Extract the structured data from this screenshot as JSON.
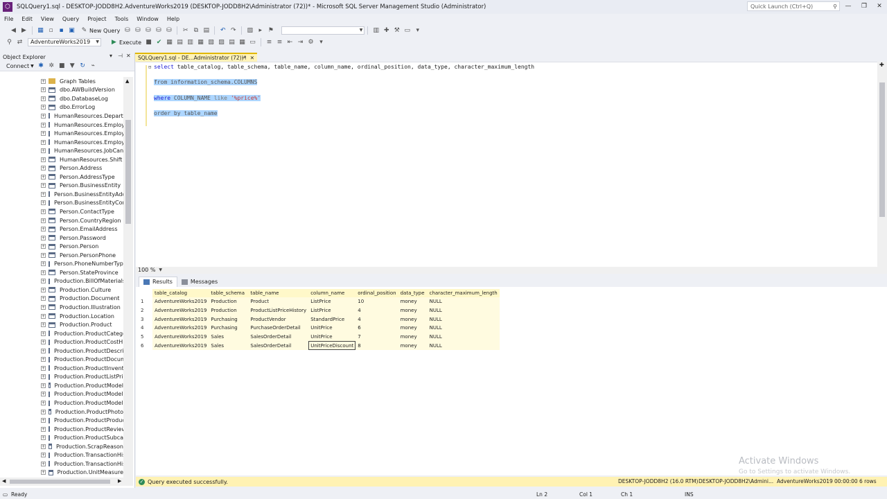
{
  "window": {
    "title": "SQLQuery1.sql - DESKTOP-JODD8H2.AdventureWorks2019 (DESKTOP-JODD8H2\\Administrator (72))* - Microsoft SQL Server Management Studio (Administrator)",
    "quick_launch_placeholder": "Quick Launch (Ctrl+Q)"
  },
  "menu": [
    "File",
    "Edit",
    "View",
    "Query",
    "Project",
    "Tools",
    "Window",
    "Help"
  ],
  "toolbar": {
    "new_query_label": "New Query",
    "database_combo_value": "AdventureWorks2019",
    "execute_label": "Execute"
  },
  "object_explorer": {
    "title": "Object Explorer",
    "connect_label": "Connect",
    "items": [
      {
        "label": "Graph Tables",
        "kind": "folder"
      },
      {
        "label": "dbo.AWBuildVersion",
        "kind": "table"
      },
      {
        "label": "dbo.DatabaseLog",
        "kind": "table"
      },
      {
        "label": "dbo.ErrorLog",
        "kind": "table"
      },
      {
        "label": "HumanResources.Departm",
        "kind": "table"
      },
      {
        "label": "HumanResources.Employe",
        "kind": "table"
      },
      {
        "label": "HumanResources.Employe",
        "kind": "table"
      },
      {
        "label": "HumanResources.Employe",
        "kind": "table"
      },
      {
        "label": "HumanResources.JobCand",
        "kind": "table"
      },
      {
        "label": "HumanResources.Shift",
        "kind": "table"
      },
      {
        "label": "Person.Address",
        "kind": "table"
      },
      {
        "label": "Person.AddressType",
        "kind": "table"
      },
      {
        "label": "Person.BusinessEntity",
        "kind": "table"
      },
      {
        "label": "Person.BusinessEntityAddre",
        "kind": "table"
      },
      {
        "label": "Person.BusinessEntityConta",
        "kind": "table"
      },
      {
        "label": "Person.ContactType",
        "kind": "table"
      },
      {
        "label": "Person.CountryRegion",
        "kind": "table"
      },
      {
        "label": "Person.EmailAddress",
        "kind": "table"
      },
      {
        "label": "Person.Password",
        "kind": "table"
      },
      {
        "label": "Person.Person",
        "kind": "table"
      },
      {
        "label": "Person.PersonPhone",
        "kind": "table"
      },
      {
        "label": "Person.PhoneNumberType",
        "kind": "table"
      },
      {
        "label": "Person.StateProvince",
        "kind": "table"
      },
      {
        "label": "Production.BillOfMaterials",
        "kind": "table"
      },
      {
        "label": "Production.Culture",
        "kind": "table"
      },
      {
        "label": "Production.Document",
        "kind": "table"
      },
      {
        "label": "Production.Illustration",
        "kind": "table"
      },
      {
        "label": "Production.Location",
        "kind": "table"
      },
      {
        "label": "Production.Product",
        "kind": "table"
      },
      {
        "label": "Production.ProductCatego",
        "kind": "table"
      },
      {
        "label": "Production.ProductCostHi",
        "kind": "table"
      },
      {
        "label": "Production.ProductDescrip",
        "kind": "table"
      },
      {
        "label": "Production.ProductDocum",
        "kind": "table"
      },
      {
        "label": "Production.ProductInvento",
        "kind": "table"
      },
      {
        "label": "Production.ProductListPric",
        "kind": "table"
      },
      {
        "label": "Production.ProductModel",
        "kind": "table"
      },
      {
        "label": "Production.ProductModelI",
        "kind": "table"
      },
      {
        "label": "Production.ProductModelP",
        "kind": "table"
      },
      {
        "label": "Production.ProductPhoto",
        "kind": "table"
      },
      {
        "label": "Production.ProductProduc",
        "kind": "table"
      },
      {
        "label": "Production.ProductReview",
        "kind": "table"
      },
      {
        "label": "Production.ProductSubcate",
        "kind": "table"
      },
      {
        "label": "Production.ScrapReason",
        "kind": "table"
      },
      {
        "label": "Production.TransactionHist",
        "kind": "table"
      },
      {
        "label": "Production.TransactionHist",
        "kind": "table"
      },
      {
        "label": "Production.UnitMeasure",
        "kind": "table"
      }
    ]
  },
  "document_tab": {
    "label": "SQLQuery1.sql - DE...Administrator (72))*"
  },
  "editor": {
    "lines": {
      "select_kw": "select",
      "select_rest": " table_catalog, table_schema, table_name, column_name, ordinal_position, data_type, character_maximum_length",
      "from_line": "from information_schema.COLUMNS",
      "where_kw": "where",
      "where_col": " COLUMN_NAME ",
      "where_like": "like ",
      "where_str": "'%price%'",
      "order_line": "order by table_name"
    },
    "zoom": "100 %"
  },
  "results": {
    "tabs": [
      "Results",
      "Messages"
    ],
    "columns": [
      "table_catalog",
      "table_schema",
      "table_name",
      "column_name",
      "ordinal_position",
      "data_type",
      "character_maximum_length"
    ],
    "rows": [
      [
        "1",
        "AdventureWorks2019",
        "Production",
        "Product",
        "ListPrice",
        "10",
        "money",
        "NULL"
      ],
      [
        "2",
        "AdventureWorks2019",
        "Production",
        "ProductListPriceHistory",
        "ListPrice",
        "4",
        "money",
        "NULL"
      ],
      [
        "3",
        "AdventureWorks2019",
        "Purchasing",
        "ProductVendor",
        "StandardPrice",
        "4",
        "money",
        "NULL"
      ],
      [
        "4",
        "AdventureWorks2019",
        "Purchasing",
        "PurchaseOrderDetail",
        "UnitPrice",
        "6",
        "money",
        "NULL"
      ],
      [
        "5",
        "AdventureWorks2019",
        "Sales",
        "SalesOrderDetail",
        "UnitPrice",
        "7",
        "money",
        "NULL"
      ],
      [
        "6",
        "AdventureWorks2019",
        "Sales",
        "SalesOrderDetail",
        "UnitPriceDiscount",
        "8",
        "money",
        "NULL"
      ]
    ]
  },
  "query_status": {
    "message": "Query executed successfully.",
    "server": "DESKTOP-JODD8H2 (16.0 RTM)",
    "user": "DESKTOP-JODD8H2\\Admini...",
    "database": "AdventureWorks2019",
    "elapsed": "00:00:00",
    "rows": "6 rows"
  },
  "app_status": {
    "ready": "Ready",
    "ln": "Ln 2",
    "col": "Col 1",
    "ch": "Ch 1",
    "ins": "INS"
  },
  "watermark": {
    "line1": "Activate Windows",
    "line2": "Go to Settings to activate Windows."
  },
  "colors": {
    "accent": "#68217a",
    "tab_active": "#fff3b8",
    "selection": "#add6ff",
    "status_bar": "#fff2b3"
  }
}
